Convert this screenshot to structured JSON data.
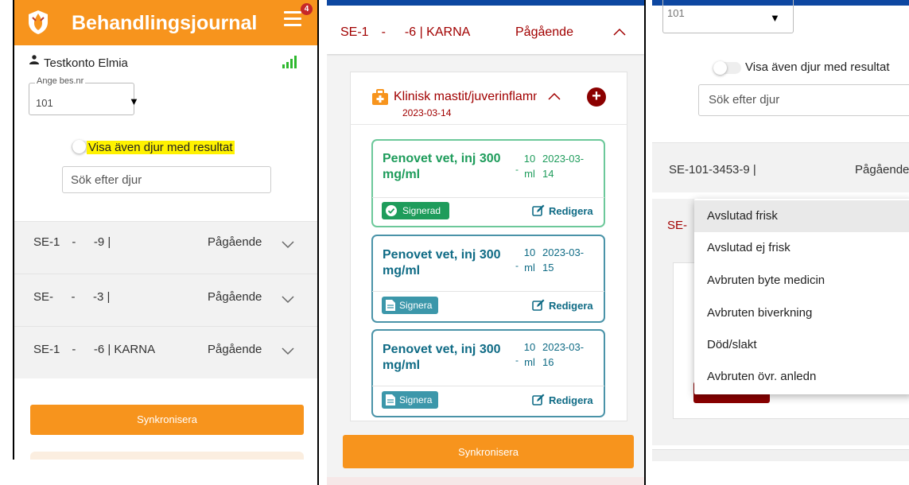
{
  "colors": {
    "brand_orange": "#f7941d",
    "dark_red": "#a10000",
    "green": "#1e9c5b",
    "teal": "#0f6b85"
  },
  "panel1": {
    "title": "Behandlingsjournal",
    "menu_badge": "4",
    "user": "Testkonto Elmia",
    "select_label": "Ange bes.nr",
    "select_value": "101",
    "toggle_label": "Visa även djur med resultat",
    "search_placeholder": "Sök efter djur",
    "rows": [
      {
        "id": "SE-1  -   -9 |",
        "status": "Pågående"
      },
      {
        "id": "SE-   -   -3 |",
        "status": "Pågående"
      },
      {
        "id": "SE-1  -   -6 | KARNA",
        "status": "Pågående"
      }
    ],
    "sync_label": "Synkronisera"
  },
  "panel2": {
    "header_id": "SE-1  -   -6 | KARNA",
    "header_status": "Pågående",
    "diagnosis": "Klinisk mastit/juverinflammation",
    "diagnosis_date": "2023-03-14",
    "treatments": [
      {
        "drug": "Penovet vet, inj 300 mg/ml",
        "dose": "10",
        "unit": "ml",
        "date": "2023-03-14",
        "state": "Signerad",
        "edit": "Redigera"
      },
      {
        "drug": "Penovet vet, inj 300 mg/ml",
        "dose": "10",
        "unit": "ml",
        "date": "2023-03-15",
        "state": "Signera",
        "edit": "Redigera"
      },
      {
        "drug": "Penovet vet, inj 300 mg/ml",
        "dose": "10",
        "unit": "ml",
        "date": "2023-03-16",
        "state": "Signera",
        "edit": "Redigera"
      }
    ],
    "sync_label": "Synkronisera"
  },
  "panel3": {
    "select_value": "101",
    "toggle_label": "Visa även djur med resultat",
    "search_placeholder": "Sök efter djur",
    "row1_id": "SE-101-3453-9 |",
    "row1_status": "Pågående",
    "row2_id": "SE-",
    "menu_options": [
      "Avslutad frisk",
      "Avslutad ej frisk",
      "Avbruten byte medicin",
      "Avbruten biverkning",
      "Död/slakt",
      "Avbruten övr. anledn"
    ],
    "selected_option": "Avslutad frisk"
  }
}
